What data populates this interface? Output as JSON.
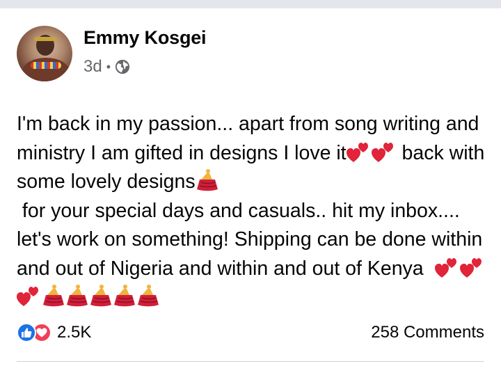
{
  "post": {
    "author": "Emmy Kosgei",
    "time": "3d",
    "separator": "•",
    "privacy_icon": "globe-icon",
    "text_segments": [
      "I'm back in my passion... apart from song writing and ministry I am gifted in designs I love it",
      " back with some lovely designs",
      "\n for your special days and casuals.. hit my inbox.... let's work on something! Shipping can be done within and out of Nigeria and within and out of Kenya  "
    ],
    "emojis": [
      "two-hearts-emoji",
      "dancer-emoji"
    ]
  },
  "footer": {
    "reaction_count": "2.5K",
    "reaction_icons": [
      "like-icon",
      "love-icon"
    ],
    "comments_label": "258 Comments"
  },
  "colors": {
    "like": "#1b74e4",
    "love": "#f33e58",
    "secondary_text": "#65676b",
    "strip": "#e4e6eb"
  }
}
